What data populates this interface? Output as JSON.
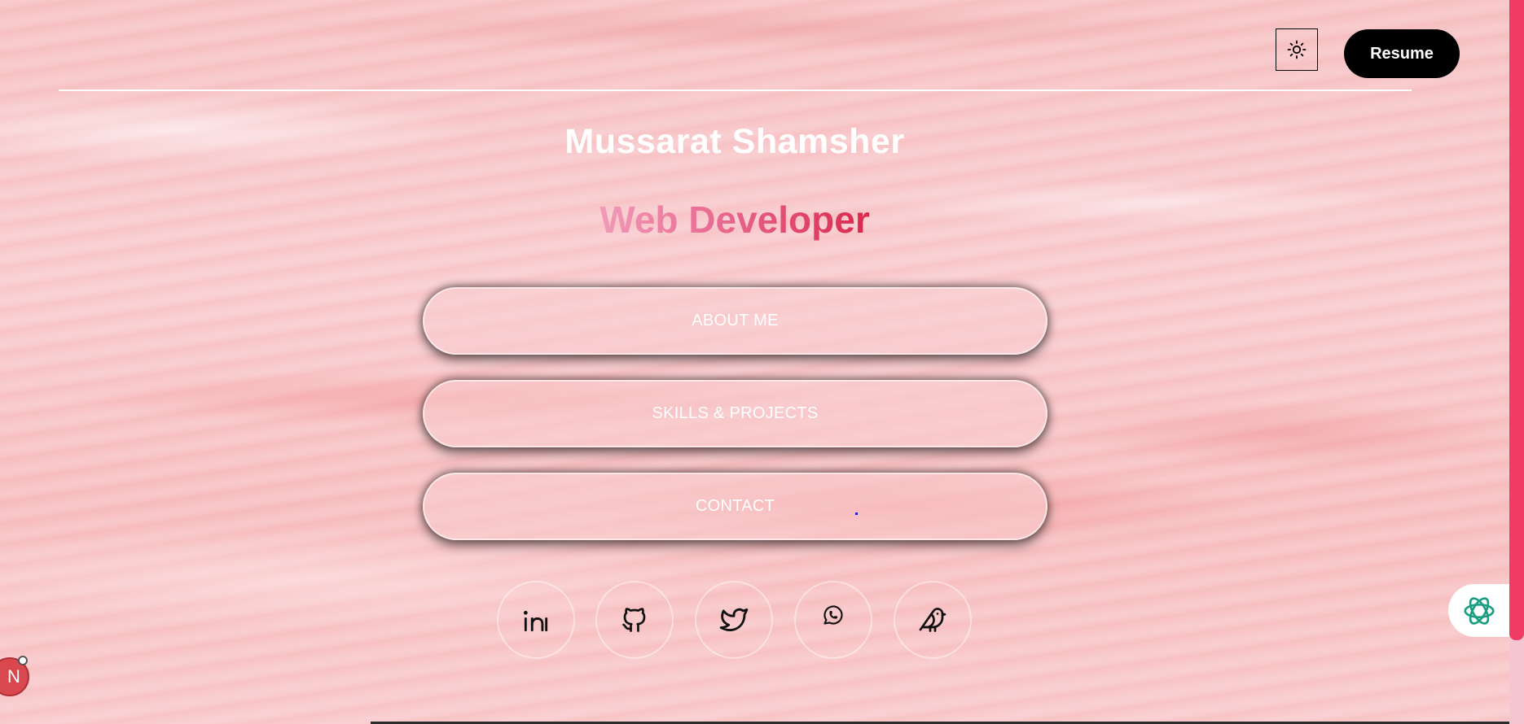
{
  "header": {
    "theme_toggle_icon": "sun-icon",
    "resume_label": "Resume"
  },
  "hero": {
    "name": "Mussarat Shamsher",
    "role": "Web Developer"
  },
  "nav": {
    "items": [
      {
        "label": "ABOUT ME"
      },
      {
        "label": "SKILLS & PROJECTS"
      },
      {
        "label": "CONTACT"
      }
    ]
  },
  "social": {
    "links": [
      {
        "icon": "linkedin-icon"
      },
      {
        "icon": "github-icon"
      },
      {
        "icon": "twitter-icon"
      },
      {
        "icon": "whatsapp-icon"
      },
      {
        "icon": "bird-icon"
      }
    ]
  },
  "widgets": {
    "chat_icon": "openai-icon",
    "badge_letter": "N"
  },
  "colors": {
    "accent": "#f03c64",
    "role_gradient": [
      "#f19ab9",
      "#e8698f",
      "#d9284c"
    ],
    "button_dark": "#000000",
    "badge": "#d9484f"
  }
}
